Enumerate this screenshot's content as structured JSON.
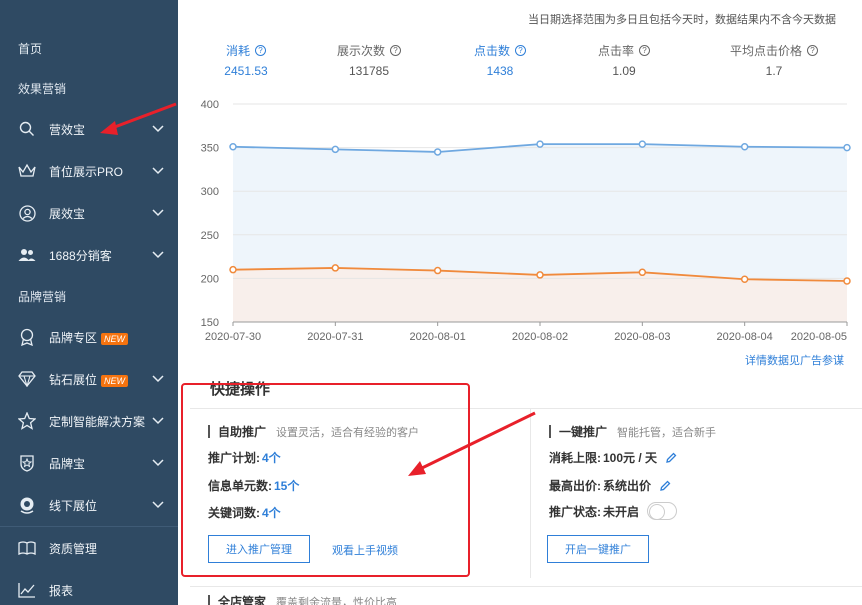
{
  "sidebar": {
    "home": "首页",
    "section1": "效果营销",
    "section2": "品牌营销",
    "items": [
      {
        "label": "营效宝",
        "icon": "search-icon",
        "expand": true
      },
      {
        "label": "首位展示PRO",
        "icon": "crown-icon",
        "expand": true
      },
      {
        "label": "展效宝",
        "icon": "user-circle-icon",
        "expand": true
      },
      {
        "label": "1688分销客",
        "icon": "people-icon",
        "expand": true
      }
    ],
    "brand_items": [
      {
        "label": "品牌专区",
        "icon": "badge-icon",
        "badge": "NEW",
        "expand": false
      },
      {
        "label": "钻石展位",
        "icon": "diamond-icon",
        "badge": "NEW",
        "expand": true
      },
      {
        "label": "定制智能解决方案",
        "icon": "star-icon",
        "expand": true
      },
      {
        "label": "品牌宝",
        "icon": "shield-star-icon",
        "expand": true
      },
      {
        "label": "线下展位",
        "icon": "location-icon",
        "expand": true
      }
    ],
    "bottom_items": [
      {
        "label": "资质管理",
        "icon": "book-icon"
      },
      {
        "label": "报表",
        "icon": "line-chart-icon"
      }
    ]
  },
  "notice": "当日期选择范围为多日且包括今天时，数据结果内不含今天数据",
  "metrics": [
    {
      "label": "消耗",
      "value": "2451.53",
      "active": true
    },
    {
      "label": "展示次数",
      "value": "131785",
      "active": false
    },
    {
      "label": "点击数",
      "value": "1438",
      "active": true
    },
    {
      "label": "点击率",
      "value": "1.09",
      "active": false
    },
    {
      "label": "平均点击价格",
      "value": "1.7",
      "active": false
    }
  ],
  "chart_data": {
    "type": "line",
    "x": [
      "2020-07-30",
      "2020-07-31",
      "2020-08-01",
      "2020-08-02",
      "2020-08-03",
      "2020-08-04",
      "2020-08-05"
    ],
    "yticks": [
      150,
      200,
      250,
      300,
      350,
      400
    ],
    "ylim": [
      150,
      400
    ],
    "series": [
      {
        "values": [
          351,
          348,
          345,
          354,
          354,
          351,
          350
        ],
        "color": "#6fa8e0"
      },
      {
        "values": [
          210,
          212,
          209,
          204,
          207,
          199,
          197
        ],
        "color": "#f08a3c"
      }
    ],
    "grid": true
  },
  "chart_link": "详情数据见广告参谋",
  "quick_ops": {
    "title": "快捷操作",
    "self_promo": {
      "title": "自助推广",
      "subtitle": "设置灵活，适合有经验的客户",
      "rows": [
        {
          "label": "推广计划:",
          "value": "4个"
        },
        {
          "label": "信息单元数:",
          "value": "15个"
        },
        {
          "label": "关键词数:",
          "value": "4个"
        }
      ],
      "button": "进入推广管理",
      "link": "观看上手视频"
    },
    "one_click": {
      "title": "一键推广",
      "subtitle": "智能托管，适合新手",
      "rows": [
        {
          "label": "消耗上限:",
          "value": "100元 / 天"
        },
        {
          "label": "最高出价:",
          "value": "系统出价"
        },
        {
          "label": "推广状态:",
          "value": "未开启"
        }
      ],
      "button": "开启一键推广"
    },
    "store_manager": {
      "title": "全店管家",
      "subtitle": "覆盖剩余流量，性价比高"
    }
  }
}
